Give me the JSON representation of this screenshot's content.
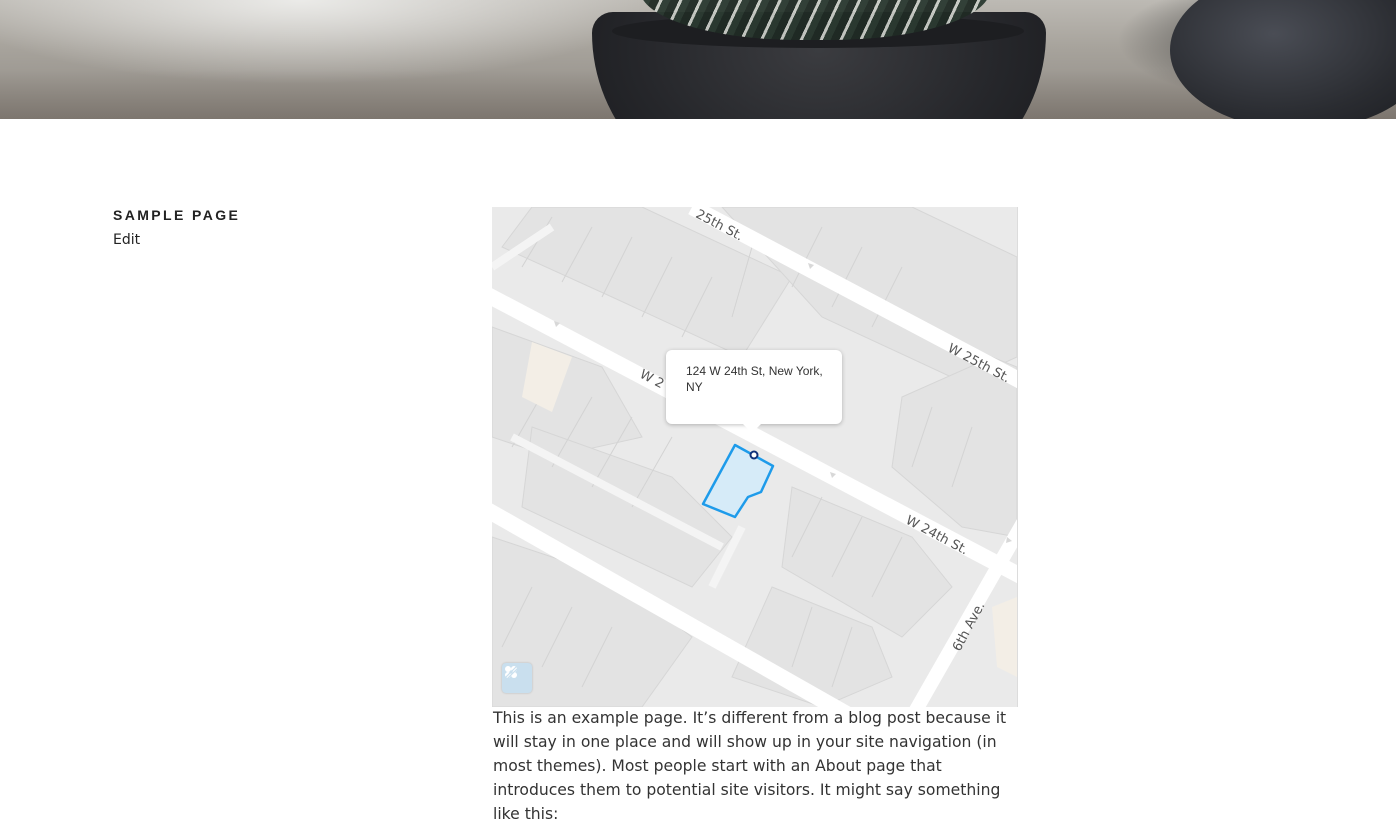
{
  "page": {
    "title": "SAMPLE PAGE",
    "edit_label": "Edit"
  },
  "map": {
    "popup_address": "124 W 24th St, New York, NY",
    "street_labels": {
      "w25_top": "25th St.",
      "w25_right": "W 25th St.",
      "w24_left": "W 2",
      "w24_right": "W 24th St.",
      "sixth_ave": "6th Ave."
    },
    "logo_icon": "mapbox-logo-icon",
    "parcel_color": "#1e9bea",
    "marker_color": "#10317a"
  },
  "content": {
    "paragraph": "This is an example page. It’s different from a blog post because it will stay in one place and will show up in your site navigation (in most themes). Most people start with an About page that introduces them to potential site visitors. It might say something like this:"
  }
}
